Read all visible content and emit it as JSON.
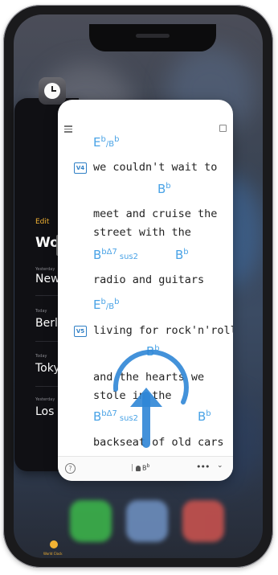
{
  "colors": {
    "chord_blue": "#4aa3e6",
    "badge_blue": "#2f7fc5",
    "clock_accent": "#f2b233"
  },
  "world_clock": {
    "edit_label": "Edit",
    "title": "Wor",
    "cities": [
      {
        "sub": "Yesterday",
        "name": "New"
      },
      {
        "sub": "Today",
        "name": "Berli"
      },
      {
        "sub": "Today",
        "name": "Toky"
      },
      {
        "sub": "Yesterday",
        "name": "Los a"
      }
    ],
    "tab_label": "World Clock"
  },
  "songsheet": {
    "lines": [
      {
        "chords": [
          {
            "root": "E",
            "acc": "b",
            "bass": "/B",
            "bassacc": "b"
          }
        ],
        "badge": "V4",
        "lyric": "we couldn't wait to"
      },
      {
        "chords": [
          {
            "root": "B",
            "acc": "b"
          }
        ],
        "lyric": "meet and cruise the"
      },
      {
        "lyric": "street with the"
      },
      {
        "chords": [
          {
            "root": "B",
            "acc": "b",
            "ext": "Δ7",
            "sus": "sus2"
          },
          {
            "root": "B",
            "acc": "b"
          }
        ],
        "lyric": "radio and guitars"
      },
      {
        "chords": [
          {
            "root": "E",
            "acc": "b",
            "bass": "/B",
            "bassacc": "b"
          }
        ],
        "badge": "V5",
        "lyric": "living for rock'n'roll"
      },
      {
        "chords": [
          {
            "root": "B",
            "acc": "b"
          }
        ],
        "lyric": "and the hearts we"
      },
      {
        "lyric": "stole in the"
      },
      {
        "chords": [
          {
            "root": "B",
            "acc": "b",
            "ext": "Δ7",
            "sus": "sus2"
          },
          {
            "root": "B",
            "acc": "b"
          }
        ],
        "lyric": "backseat of old cars"
      }
    ],
    "bottom_bar": {
      "help": "?",
      "tuner_note": "B",
      "tuner_acc": "b",
      "more": "•••",
      "chevron": "⌄"
    }
  }
}
